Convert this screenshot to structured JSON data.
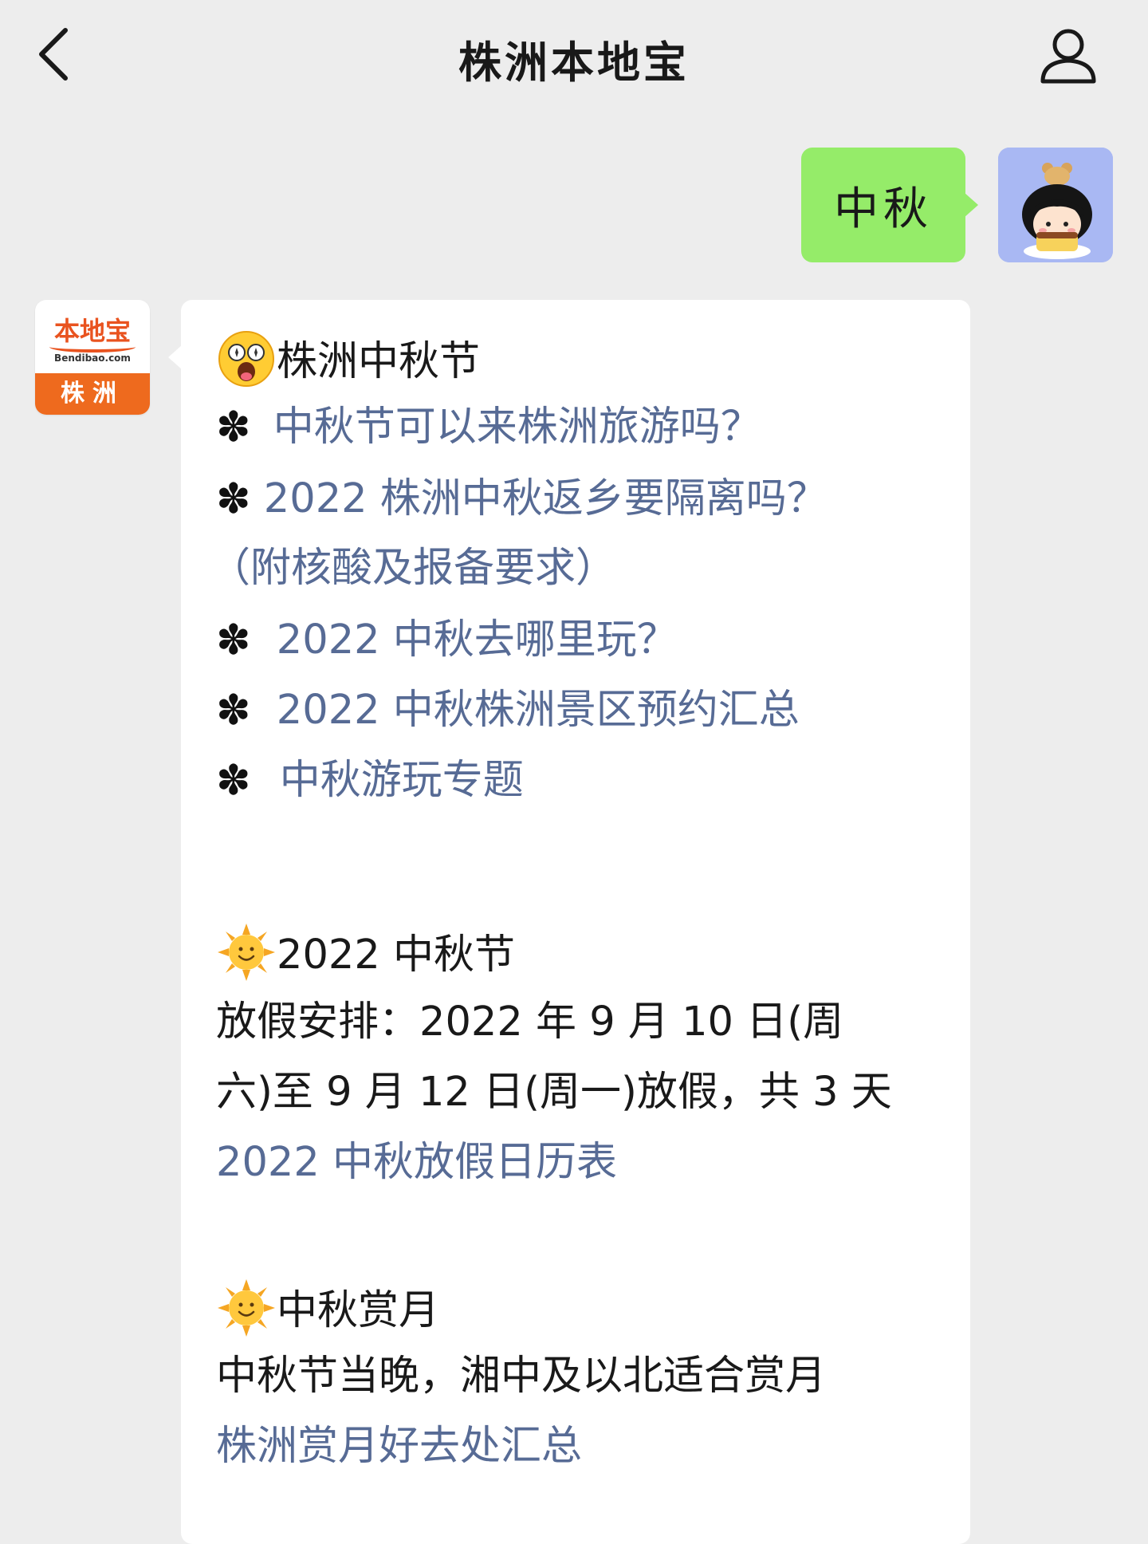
{
  "header": {
    "title": "株洲本地宝"
  },
  "chat": {
    "user_message": "中秋",
    "bot_avatar": {
      "logo_text": "本地宝",
      "domain": "Bendibao.com",
      "city": "株洲"
    },
    "bot_message": {
      "section1_title": "株洲中秋节",
      "bullet_glyph": "✽",
      "links1": [
        "中秋节可以来株洲旅游吗？",
        "2022 株洲中秋返乡要隔离吗？",
        "（附核酸及报备要求）",
        "2022 中秋去哪里玩？",
        "2022 中秋株洲景区预约汇总",
        "中秋游玩专题"
      ],
      "section2_title": "2022 中秋节",
      "section2_text_1": "放假安排：2022 年 9 月 10 日(周",
      "section2_text_2": "六)至 9 月 12 日(周一)放假，共 3 天",
      "section2_link": "2022 中秋放假日历表",
      "section3_title": "中秋赏月",
      "section3_text": "中秋节当晚，湘中及以北适合赏月",
      "section3_link": "株洲赏月好去处汇总"
    }
  },
  "colors": {
    "background": "#ededed",
    "user_bubble": "#95ec69",
    "link": "#576b95",
    "logo_orange": "#ee6a1e"
  }
}
